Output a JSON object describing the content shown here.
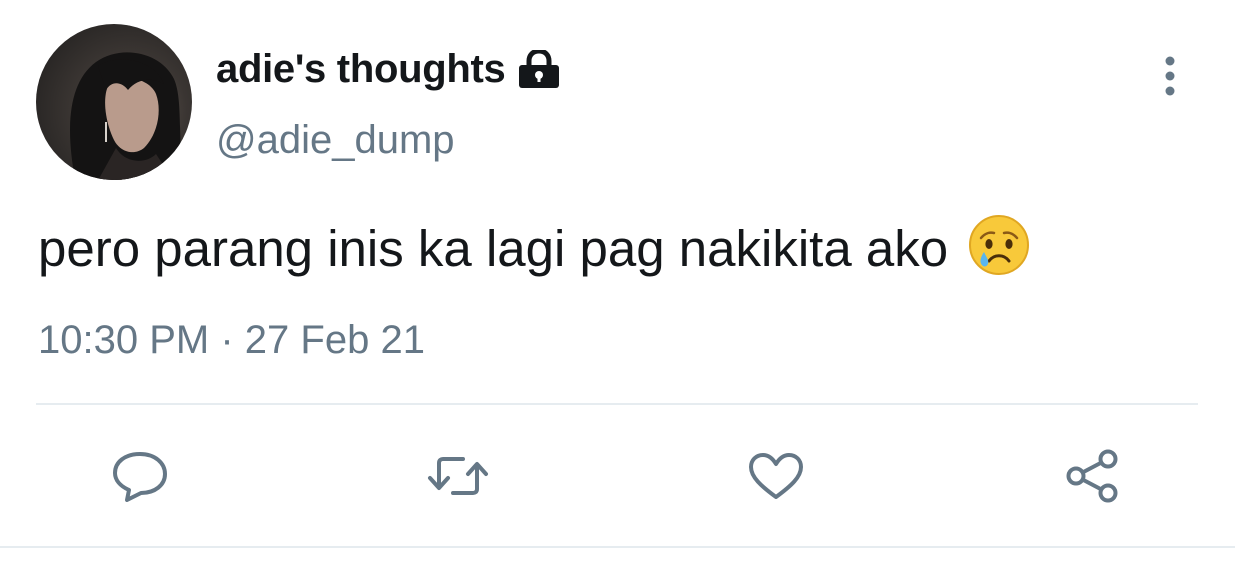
{
  "tweet": {
    "display_name": "adie's thoughts",
    "handle": "@adie_dump",
    "text": "pero parang inis ka lagi pag nakikita ako",
    "emoji": "crying-face",
    "time": "10:30 PM",
    "separator": "·",
    "date": "27 Feb 21",
    "protected": true
  },
  "icons": {
    "lock": "lock-icon",
    "more": "more-vertical-icon",
    "reply": "reply-icon",
    "retweet": "retweet-icon",
    "like": "heart-icon",
    "share": "share-icon"
  },
  "colors": {
    "text_primary": "#14171a",
    "text_secondary": "#657786",
    "divider": "#e6ecf0"
  }
}
